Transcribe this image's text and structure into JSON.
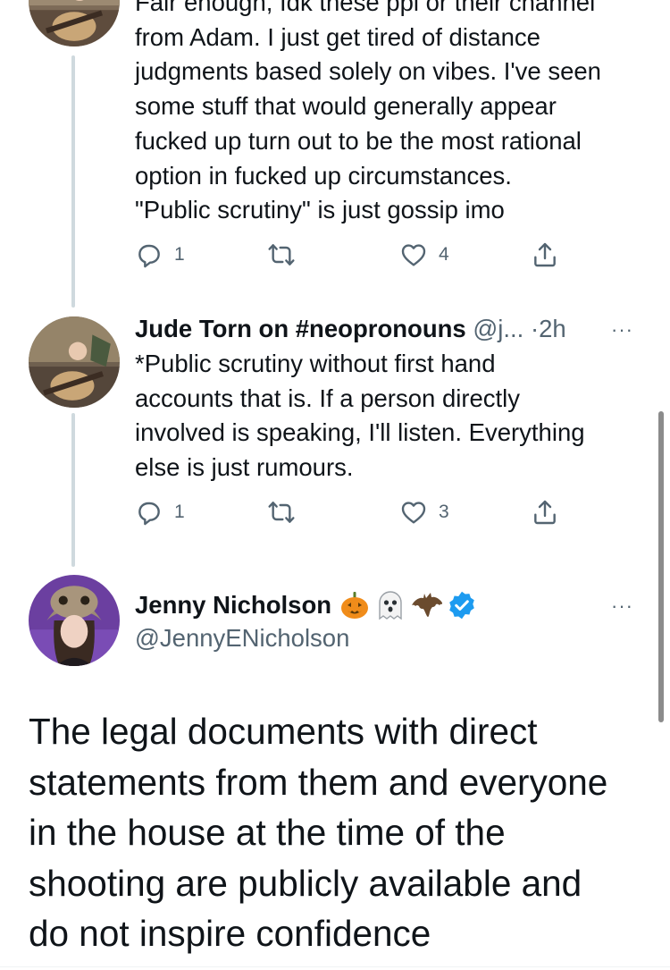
{
  "tweets": [
    {
      "text": "Fair enough, Idk these ppl or their channel\nfrom Adam. I just get tired of distance\njudgments based solely on vibes. I've seen\nsome stuff that would generally appear\nfucked up turn out to be the most rational\noption in fucked up circumstances.\n\"Public scrutiny\" is just gossip imo",
      "replies": "1",
      "likes": "4"
    },
    {
      "name": "Jude Torn on #neopronouns",
      "handle": "@j...",
      "dot": "·",
      "time": "2h",
      "text": "*Public scrutiny without first hand\naccounts that is. If a person directly\ninvolved is speaking, I'll listen. Everything\nelse is just rumours.",
      "replies": "1",
      "likes": "3"
    }
  ],
  "main_tweet": {
    "name": "Jenny Nicholson",
    "handle": "@JennyENicholson",
    "name_emojis": [
      "pumpkin-icon",
      "ghost-icon",
      "bat-icon"
    ],
    "verified_icon": "verified-badge-icon",
    "text": "The legal documents with direct\nstatements from them and everyone\nin the house at the time of the\nshooting are publicly available and\ndo not inspire confidence"
  },
  "more_label": "···",
  "colors": {
    "text": "#0f1419",
    "secondary": "#536471",
    "thread": "#cfd9de",
    "verified": "#1d9bf0"
  }
}
